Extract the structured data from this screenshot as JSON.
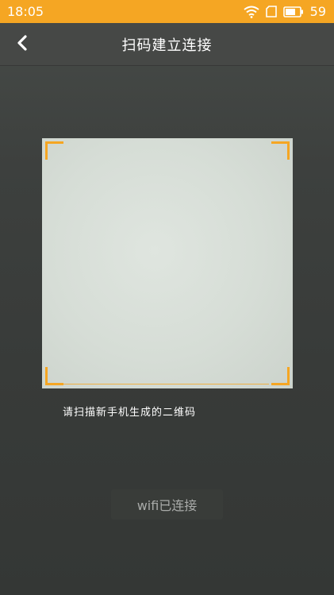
{
  "status_bar": {
    "time": "18:05",
    "battery_level": "59",
    "icons": [
      "wifi-icon",
      "sim-card-icon",
      "battery-icon"
    ]
  },
  "nav": {
    "back_icon": "chevron-left-icon",
    "title": "扫码建立连接"
  },
  "scanner": {
    "hint": "请扫描新手机生成的二维码",
    "accent_color": "#f5a623"
  },
  "wifi": {
    "status": "wifi已连接"
  },
  "colors": {
    "status_bar": "#f5a623",
    "background": "#3a3d3b",
    "text_primary": "#ffffff",
    "text_muted": "#a9aba9"
  }
}
